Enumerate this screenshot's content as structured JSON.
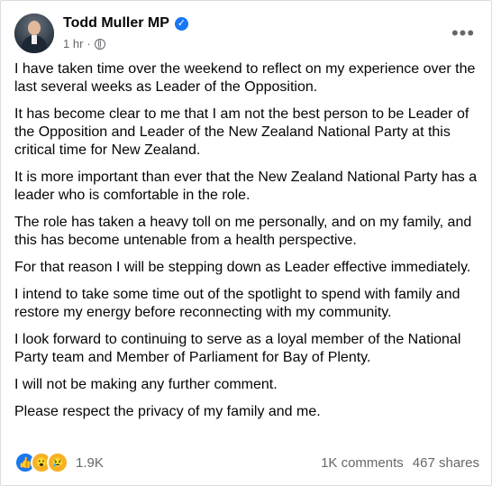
{
  "post": {
    "author": "Todd Muller MP",
    "time": "1 hr",
    "separator": "·",
    "paragraphs": [
      "I have taken time over the weekend to reflect on my experience over the last several weeks as Leader of the Opposition.",
      "It has become clear to me that I am not the best person to be Leader of the Opposition and Leader of the New Zealand National Party at this critical time for New Zealand.",
      "It is more important than ever that the New Zealand National Party has a leader who is comfortable in the role.",
      "The role has taken a heavy toll on me personally, and on my family, and this has become untenable from a health perspective.",
      "For that reason I will be stepping down as Leader effective immediately.",
      "I intend to take some time out of the spotlight to spend with family and restore my energy before reconnecting with my community.",
      "I look forward to continuing to serve as a loyal member of the National Party team and Member of Parliament for Bay of Plenty.",
      "I will not be making any further comment.",
      "Please respect the privacy of my family and me."
    ]
  },
  "stats": {
    "reactions_count": "1.9K",
    "comments": "1K comments",
    "shares": "467 shares"
  },
  "icons": {
    "verified": "verified-badge-icon",
    "privacy": "globe-icon",
    "more": "more-options-icon",
    "reactions": [
      "like-reaction-icon",
      "wow-reaction-icon",
      "sad-reaction-icon"
    ]
  },
  "colors": {
    "accent": "#1877f2",
    "text": "#050505",
    "secondary": "#65676b",
    "reaction_yellow": "#f7b125"
  }
}
